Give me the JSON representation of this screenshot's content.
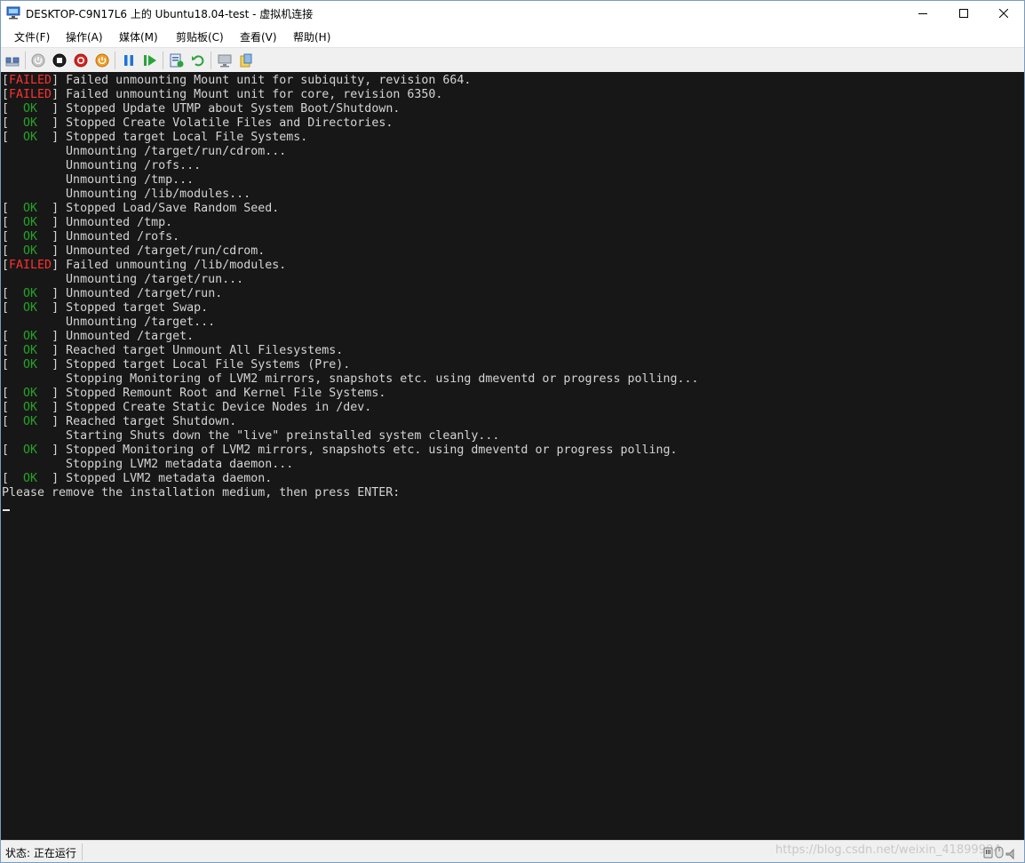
{
  "window": {
    "title": "DESKTOP-C9N17L6 上的 Ubuntu18.04-test - 虚拟机连接"
  },
  "menu": [
    "文件(F)",
    "操作(A)",
    "媒体(M)",
    "剪贴板(C)",
    "查看(V)",
    "帮助(H)"
  ],
  "toolbar": {
    "buttons": [
      "ctrl-alt-del",
      "start",
      "turn-off",
      "shutdown",
      "save",
      "pause",
      "resume",
      "checkpoint",
      "revert",
      "enhanced-session",
      "share"
    ]
  },
  "console": {
    "status_prefix_open": "[",
    "status_prefix_close": "]",
    "lines": [
      {
        "status": "FAILED",
        "text": "Failed unmounting Mount unit for subiquity, revision 664."
      },
      {
        "status": "FAILED",
        "text": "Failed unmounting Mount unit for core, revision 6350."
      },
      {
        "status": "OK",
        "text": "Stopped Update UTMP about System Boot/Shutdown."
      },
      {
        "status": "OK",
        "text": "Stopped Create Volatile Files and Directories."
      },
      {
        "status": "OK",
        "text": "Stopped target Local File Systems."
      },
      {
        "status": "",
        "text": "Unmounting /target/run/cdrom..."
      },
      {
        "status": "",
        "text": "Unmounting /rofs..."
      },
      {
        "status": "",
        "text": "Unmounting /tmp..."
      },
      {
        "status": "",
        "text": "Unmounting /lib/modules..."
      },
      {
        "status": "OK",
        "text": "Stopped Load/Save Random Seed."
      },
      {
        "status": "OK",
        "text": "Unmounted /tmp."
      },
      {
        "status": "OK",
        "text": "Unmounted /rofs."
      },
      {
        "status": "OK",
        "text": "Unmounted /target/run/cdrom."
      },
      {
        "status": "FAILED",
        "text": "Failed unmounting /lib/modules."
      },
      {
        "status": "",
        "text": "Unmounting /target/run..."
      },
      {
        "status": "OK",
        "text": "Unmounted /target/run."
      },
      {
        "status": "OK",
        "text": "Stopped target Swap."
      },
      {
        "status": "",
        "text": "Unmounting /target..."
      },
      {
        "status": "OK",
        "text": "Unmounted /target."
      },
      {
        "status": "OK",
        "text": "Reached target Unmount All Filesystems."
      },
      {
        "status": "OK",
        "text": "Stopped target Local File Systems (Pre)."
      },
      {
        "status": "",
        "text": "Stopping Monitoring of LVM2 mirrors, snapshots etc. using dmeventd or progress polling..."
      },
      {
        "status": "OK",
        "text": "Stopped Remount Root and Kernel File Systems."
      },
      {
        "status": "OK",
        "text": "Stopped Create Static Device Nodes in /dev."
      },
      {
        "status": "OK",
        "text": "Reached target Shutdown."
      },
      {
        "status": "",
        "text": "Starting Shuts down the \"live\" preinstalled system cleanly..."
      },
      {
        "status": "OK",
        "text": "Stopped Monitoring of LVM2 mirrors, snapshots etc. using dmeventd or progress polling."
      },
      {
        "status": "",
        "text": "Stopping LVM2 metadata daemon..."
      },
      {
        "status": "OK",
        "text": "Stopped LVM2 metadata daemon."
      }
    ],
    "prompt": "Please remove the installation medium, then press ENTER:"
  },
  "statusbar": {
    "text": "状态: 正在运行",
    "watermark": "https://blog.csdn.net/weixin_41899904"
  },
  "colors": {
    "failed": "#ff3030",
    "ok": "#27a327",
    "console_bg": "#171717",
    "console_fg": "#d4d4d4"
  }
}
